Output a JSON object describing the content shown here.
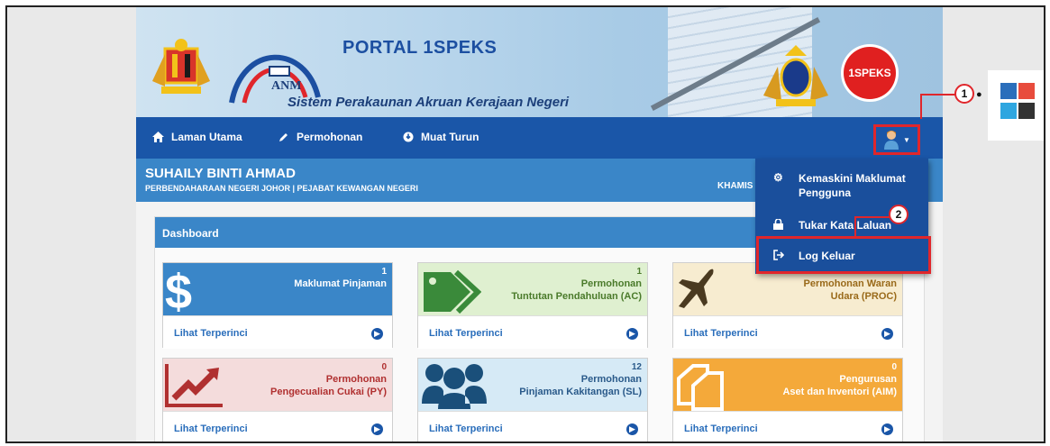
{
  "header": {
    "title": "PORTAL 1SPEKS",
    "subtitle": "Sistem Perakaunan Akruan Kerajaan Negeri",
    "anm": "ANM",
    "speks_badge": "1SPEKS"
  },
  "nav": {
    "items": [
      {
        "label": "Laman Utama",
        "icon": "home-icon"
      },
      {
        "label": "Permohonan",
        "icon": "pencil-icon"
      },
      {
        "label": "Muat Turun",
        "icon": "download-icon"
      }
    ]
  },
  "user": {
    "name": "SUHAILY BINTI AHMAD",
    "department": "PERBENDAHARAAN NEGERI JOHOR | PEJABAT KEWANGAN NEGERI",
    "day": "KHAMIS"
  },
  "dashboard": {
    "title": "Dashboard",
    "detail_label": "Lihat Terperinci",
    "cards": [
      {
        "count": "1",
        "label": "Maklumat Pinjaman",
        "bg": "#3a86c8",
        "text": "#ffffff",
        "icon": "dollar-icon"
      },
      {
        "count": "1",
        "label": "Permohonan\nTuntutan Pendahuluan (AC)",
        "bg": "#dff0d0",
        "text": "#4a7a2a",
        "icon": "tag-icon"
      },
      {
        "count": "",
        "label": "Permohonan Waran\nUdara (PROC)",
        "bg": "#f7ecd0",
        "text": "#9a6a1a",
        "icon": "plane-icon"
      },
      {
        "count": "0",
        "label": "Permohonan\nPengecualian Cukai (PY)",
        "bg": "#f4dcdc",
        "text": "#b03030",
        "icon": "chart-up-icon"
      },
      {
        "count": "12",
        "label": "Permohonan\nPinjaman Kakitangan (SL)",
        "bg": "#d6eaf6",
        "text": "#2a5a8a",
        "icon": "users-icon"
      },
      {
        "count": "0",
        "label": "Pengurusan\nAset dan Inventori (AIM)",
        "bg": "#f4a93a",
        "text": "#ffffff",
        "icon": "files-icon"
      }
    ]
  },
  "dropdown": {
    "items": [
      {
        "label": "Kemaskini Maklumat\nPengguna",
        "icon": "gear-icon"
      },
      {
        "label": "Tukar Kata Laluan",
        "icon": "lock-icon"
      },
      {
        "label": "Log Keluar",
        "icon": "logout-icon"
      }
    ]
  },
  "callouts": [
    "1",
    "2"
  ],
  "theme": {
    "colors": [
      "#2a6ebb",
      "#e84c3d",
      "#2ea6e0",
      "#333333"
    ]
  }
}
